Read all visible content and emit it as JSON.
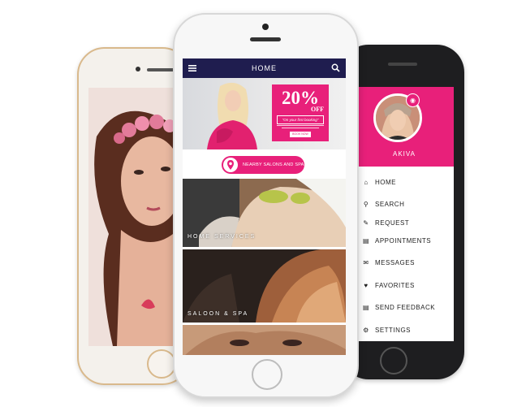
{
  "center_app": {
    "header": {
      "title": "HOME",
      "menu_icon": "hamburger-icon",
      "search_icon": "search-icon"
    },
    "promo": {
      "percent": "20%",
      "off_label": "OFF",
      "subtitle": "\"On your first booking\"",
      "book_label": "BOOK NOW"
    },
    "nearby_button": {
      "label": "NEARBY SALONS AND SPAS",
      "icon": "location-pin-icon"
    },
    "tiles": [
      {
        "label": "HOME SERVICES"
      },
      {
        "label": "SALOON & SPA"
      }
    ]
  },
  "side_menu": {
    "user_name": "AKIVA",
    "camera_icon": "camera-icon",
    "items": [
      {
        "label": "HOME",
        "icon": "home-icon"
      },
      {
        "label": "SEARCH",
        "icon": "search-icon"
      },
      {
        "label": "REQUEST",
        "icon": "request-icon"
      },
      {
        "label": "APPOINTMENTS",
        "icon": "calendar-icon"
      },
      {
        "label": "MESSAGES",
        "icon": "envelope-icon"
      },
      {
        "label": "FAVORITES",
        "icon": "heart-icon"
      },
      {
        "label": "SEND FEEDBACK",
        "icon": "feedback-icon"
      },
      {
        "label": "SETTINGS",
        "icon": "gear-icon"
      }
    ]
  },
  "colors": {
    "accent": "#e8207a",
    "navbar": "#1f1d4f",
    "gold_frame": "#d9b98c",
    "dark_frame": "#1e1e20"
  }
}
